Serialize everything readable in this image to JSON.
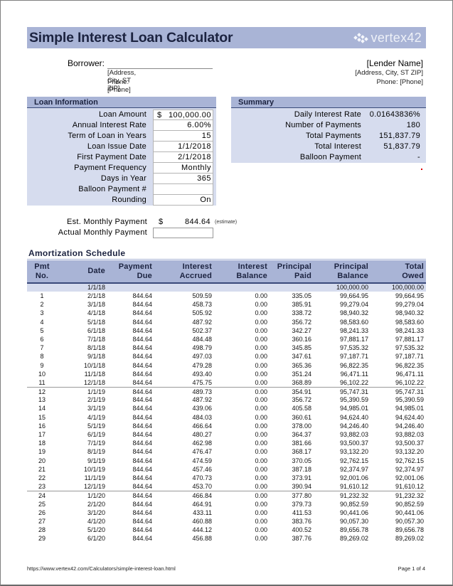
{
  "header": {
    "title": "Simple Interest Loan Calculator",
    "logo_text": "vertex42",
    "logo_icon": "vertex42-logo-icon"
  },
  "borrower": {
    "label": "Borrower:",
    "name_value": "",
    "address": "[Address, City, ST  ZIP]",
    "phone": "Phone: [Phone]"
  },
  "lender": {
    "name": "[Lender Name]",
    "address": "[Address, City, ST  ZIP]",
    "phone": "Phone: [Phone]"
  },
  "loan_info": {
    "heading": "Loan Information",
    "fields": [
      {
        "label": "Loan Amount",
        "currency": "$",
        "value": "100,000.00"
      },
      {
        "label": "Annual Interest Rate",
        "currency": "",
        "value": "6.00%"
      },
      {
        "label": "Term of Loan in Years",
        "currency": "",
        "value": "15"
      },
      {
        "label": "Loan Issue Date",
        "currency": "",
        "value": "1/1/2018"
      },
      {
        "label": "First Payment Date",
        "currency": "",
        "value": "2/1/2018"
      },
      {
        "label": "Payment Frequency",
        "currency": "",
        "value": "Monthly"
      },
      {
        "label": "Days in Year",
        "currency": "",
        "value": "365"
      },
      {
        "label": "Balloon Payment #",
        "currency": "",
        "value": ""
      },
      {
        "label": "Rounding",
        "currency": "",
        "value": "On"
      }
    ]
  },
  "summary": {
    "heading": "Summary",
    "fields": [
      {
        "label": "Daily Interest Rate",
        "value": "0.01643836%"
      },
      {
        "label": "Number of Payments",
        "value": "180"
      },
      {
        "label": "Total Payments",
        "value": "151,837.79"
      },
      {
        "label": "Total Interest",
        "value": "51,837.79"
      },
      {
        "label": "Balloon Payment",
        "value": "-"
      }
    ]
  },
  "payment": {
    "est_label": "Est. Monthly Payment",
    "est_currency": "$",
    "est_value": "844.64",
    "est_note": "(estimate)",
    "actual_label": "Actual Monthly Payment",
    "actual_value": ""
  },
  "amortization": {
    "title": "Amortization Schedule",
    "columns": [
      {
        "line1": "Pmt",
        "line2": "No."
      },
      {
        "line1": "Date",
        "line2": ""
      },
      {
        "line1": "Payment",
        "line2": "Due"
      },
      {
        "line1": "Interest",
        "line2": "Accrued"
      },
      {
        "line1": "Interest",
        "line2": "Balance"
      },
      {
        "line1": "Principal",
        "line2": "Paid"
      },
      {
        "line1": "Principal",
        "line2": "Balance"
      },
      {
        "line1": "Total",
        "line2": "Owed"
      }
    ],
    "initial_row": [
      "",
      "1/1/18",
      "",
      "",
      "",
      "",
      "100,000.00",
      "100,000.00"
    ],
    "rows": [
      [
        "1",
        "2/1/18",
        "844.64",
        "509.59",
        "0.00",
        "335.05",
        "99,664.95",
        "99,664.95"
      ],
      [
        "2",
        "3/1/18",
        "844.64",
        "458.73",
        "0.00",
        "385.91",
        "99,279.04",
        "99,279.04"
      ],
      [
        "3",
        "4/1/18",
        "844.64",
        "505.92",
        "0.00",
        "338.72",
        "98,940.32",
        "98,940.32"
      ],
      [
        "4",
        "5/1/18",
        "844.64",
        "487.92",
        "0.00",
        "356.72",
        "98,583.60",
        "98,583.60"
      ],
      [
        "5",
        "6/1/18",
        "844.64",
        "502.37",
        "0.00",
        "342.27",
        "98,241.33",
        "98,241.33"
      ],
      [
        "6",
        "7/1/18",
        "844.64",
        "484.48",
        "0.00",
        "360.16",
        "97,881.17",
        "97,881.17"
      ],
      [
        "7",
        "8/1/18",
        "844.64",
        "498.79",
        "0.00",
        "345.85",
        "97,535.32",
        "97,535.32"
      ],
      [
        "8",
        "9/1/18",
        "844.64",
        "497.03",
        "0.00",
        "347.61",
        "97,187.71",
        "97,187.71"
      ],
      [
        "9",
        "10/1/18",
        "844.64",
        "479.28",
        "0.00",
        "365.36",
        "96,822.35",
        "96,822.35"
      ],
      [
        "10",
        "11/1/18",
        "844.64",
        "493.40",
        "0.00",
        "351.24",
        "96,471.11",
        "96,471.11"
      ],
      [
        "11",
        "12/1/18",
        "844.64",
        "475.75",
        "0.00",
        "368.89",
        "96,102.22",
        "96,102.22"
      ],
      [
        "12",
        "1/1/19",
        "844.64",
        "489.73",
        "0.00",
        "354.91",
        "95,747.31",
        "95,747.31"
      ],
      [
        "13",
        "2/1/19",
        "844.64",
        "487.92",
        "0.00",
        "356.72",
        "95,390.59",
        "95,390.59"
      ],
      [
        "14",
        "3/1/19",
        "844.64",
        "439.06",
        "0.00",
        "405.58",
        "94,985.01",
        "94,985.01"
      ],
      [
        "15",
        "4/1/19",
        "844.64",
        "484.03",
        "0.00",
        "360.61",
        "94,624.40",
        "94,624.40"
      ],
      [
        "16",
        "5/1/19",
        "844.64",
        "466.64",
        "0.00",
        "378.00",
        "94,246.40",
        "94,246.40"
      ],
      [
        "17",
        "6/1/19",
        "844.64",
        "480.27",
        "0.00",
        "364.37",
        "93,882.03",
        "93,882.03"
      ],
      [
        "18",
        "7/1/19",
        "844.64",
        "462.98",
        "0.00",
        "381.66",
        "93,500.37",
        "93,500.37"
      ],
      [
        "19",
        "8/1/19",
        "844.64",
        "476.47",
        "0.00",
        "368.17",
        "93,132.20",
        "93,132.20"
      ],
      [
        "20",
        "9/1/19",
        "844.64",
        "474.59",
        "0.00",
        "370.05",
        "92,762.15",
        "92,762.15"
      ],
      [
        "21",
        "10/1/19",
        "844.64",
        "457.46",
        "0.00",
        "387.18",
        "92,374.97",
        "92,374.97"
      ],
      [
        "22",
        "11/1/19",
        "844.64",
        "470.73",
        "0.00",
        "373.91",
        "92,001.06",
        "92,001.06"
      ],
      [
        "23",
        "12/1/19",
        "844.64",
        "453.70",
        "0.00",
        "390.94",
        "91,610.12",
        "91,610.12"
      ],
      [
        "24",
        "1/1/20",
        "844.64",
        "466.84",
        "0.00",
        "377.80",
        "91,232.32",
        "91,232.32"
      ],
      [
        "25",
        "2/1/20",
        "844.64",
        "464.91",
        "0.00",
        "379.73",
        "90,852.59",
        "90,852.59"
      ],
      [
        "26",
        "3/1/20",
        "844.64",
        "433.11",
        "0.00",
        "411.53",
        "90,441.06",
        "90,441.06"
      ],
      [
        "27",
        "4/1/20",
        "844.64",
        "460.88",
        "0.00",
        "383.76",
        "90,057.30",
        "90,057.30"
      ],
      [
        "28",
        "5/1/20",
        "844.64",
        "444.12",
        "0.00",
        "400.52",
        "89,656.78",
        "89,656.78"
      ],
      [
        "29",
        "6/1/20",
        "844.64",
        "456.88",
        "0.00",
        "387.76",
        "89,269.02",
        "89,269.02"
      ]
    ],
    "year_separator_after": [
      "11",
      "23"
    ]
  },
  "footer": {
    "url": "https://www.vertex42.com/Calculators/simple-interest-loan.html",
    "page": "Page 1 of 4"
  },
  "colors": {
    "header_bg": "#a9b4d6",
    "panel_bg": "#d6dcee",
    "title_text": "#1c2340",
    "rule": "#3a4a7a"
  }
}
